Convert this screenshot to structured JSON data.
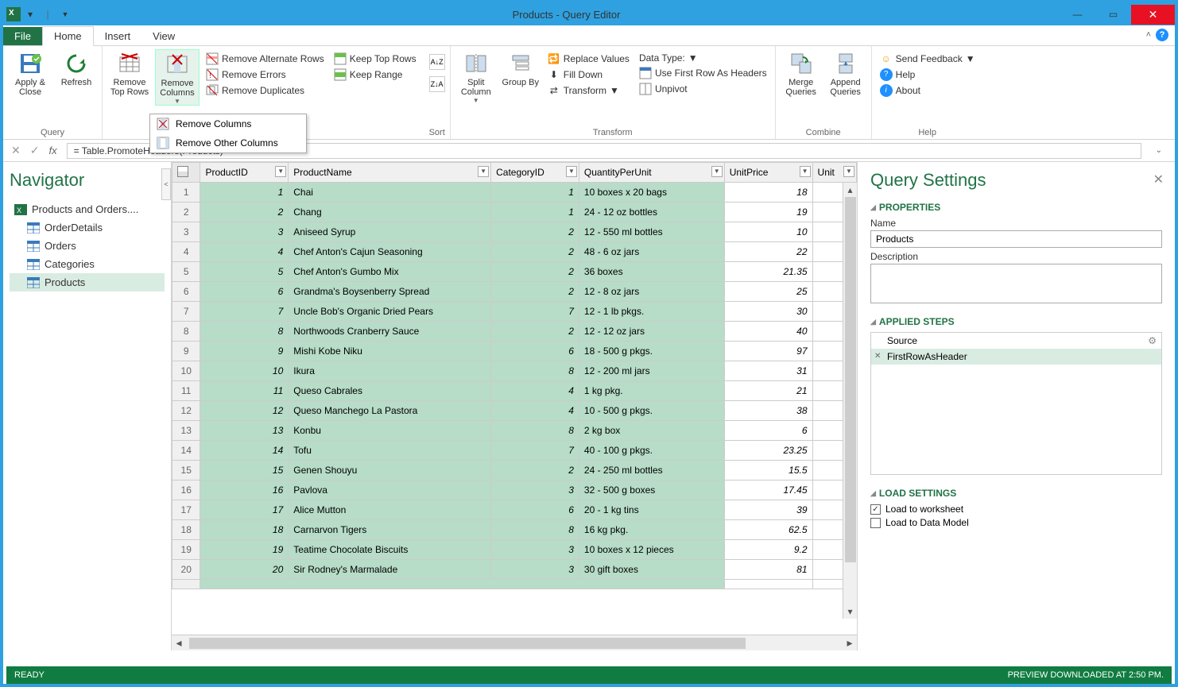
{
  "title": "Products - Query Editor",
  "tabs": {
    "file": "File",
    "home": "Home",
    "insert": "Insert",
    "view": "View"
  },
  "ribbon": {
    "query": {
      "apply_close": "Apply & Close",
      "refresh": "Refresh",
      "label": "Query"
    },
    "remove_top": "Remove Top Rows",
    "remove_cols": "Remove Columns",
    "remove_alt": "Remove Alternate Rows",
    "remove_errors": "Remove Errors",
    "remove_dup": "Remove Duplicates",
    "keep_top": "Keep Top Rows",
    "keep_range": "Keep Range",
    "sort_label": "Sort",
    "split_col": "Split Column",
    "group_by": "Group By",
    "replace": "Replace Values",
    "fill_down": "Fill Down",
    "transform": "Transform",
    "data_type": "Data Type:",
    "first_row": "Use First Row As Headers",
    "unpivot": "Unpivot",
    "transform_label": "Transform",
    "merge": "Merge Queries",
    "append": "Append Queries",
    "combine_label": "Combine",
    "feedback": "Send Feedback",
    "help": "Help",
    "about": "About",
    "help_label": "Help"
  },
  "dropdown": {
    "remove_cols": "Remove Columns",
    "remove_other": "Remove Other Columns"
  },
  "formula": "= Table.PromoteHeaders(Products)",
  "navigator": {
    "title": "Navigator",
    "root": "Products and Orders....",
    "items": [
      "OrderDetails",
      "Orders",
      "Categories",
      "Products"
    ],
    "selected": "Products"
  },
  "columns": [
    "ProductID",
    "ProductName",
    "CategoryID",
    "QuantityPerUnit",
    "UnitPrice",
    "Unit"
  ],
  "rows": [
    {
      "n": 1,
      "id": "1",
      "name": "Chai",
      "cat": "1",
      "qpu": "10 boxes x 20 bags",
      "price": "18"
    },
    {
      "n": 2,
      "id": "2",
      "name": "Chang",
      "cat": "1",
      "qpu": "24 - 12 oz bottles",
      "price": "19"
    },
    {
      "n": 3,
      "id": "3",
      "name": "Aniseed Syrup",
      "cat": "2",
      "qpu": "12 - 550 ml bottles",
      "price": "10"
    },
    {
      "n": 4,
      "id": "4",
      "name": "Chef Anton's Cajun Seasoning",
      "cat": "2",
      "qpu": "48 - 6 oz jars",
      "price": "22"
    },
    {
      "n": 5,
      "id": "5",
      "name": "Chef Anton's Gumbo Mix",
      "cat": "2",
      "qpu": "36 boxes",
      "price": "21.35"
    },
    {
      "n": 6,
      "id": "6",
      "name": "Grandma's Boysenberry Spread",
      "cat": "2",
      "qpu": "12 - 8 oz jars",
      "price": "25"
    },
    {
      "n": 7,
      "id": "7",
      "name": "Uncle Bob's Organic Dried Pears",
      "cat": "7",
      "qpu": "12 - 1 lb pkgs.",
      "price": "30"
    },
    {
      "n": 8,
      "id": "8",
      "name": "Northwoods Cranberry Sauce",
      "cat": "2",
      "qpu": "12 - 12 oz jars",
      "price": "40"
    },
    {
      "n": 9,
      "id": "9",
      "name": "Mishi Kobe Niku",
      "cat": "6",
      "qpu": "18 - 500 g pkgs.",
      "price": "97"
    },
    {
      "n": 10,
      "id": "10",
      "name": "Ikura",
      "cat": "8",
      "qpu": "12 - 200 ml jars",
      "price": "31"
    },
    {
      "n": 11,
      "id": "11",
      "name": "Queso Cabrales",
      "cat": "4",
      "qpu": "1 kg pkg.",
      "price": "21"
    },
    {
      "n": 12,
      "id": "12",
      "name": "Queso Manchego La Pastora",
      "cat": "4",
      "qpu": "10 - 500 g pkgs.",
      "price": "38"
    },
    {
      "n": 13,
      "id": "13",
      "name": "Konbu",
      "cat": "8",
      "qpu": "2 kg box",
      "price": "6"
    },
    {
      "n": 14,
      "id": "14",
      "name": "Tofu",
      "cat": "7",
      "qpu": "40 - 100 g pkgs.",
      "price": "23.25"
    },
    {
      "n": 15,
      "id": "15",
      "name": "Genen Shouyu",
      "cat": "2",
      "qpu": "24 - 250 ml bottles",
      "price": "15.5"
    },
    {
      "n": 16,
      "id": "16",
      "name": "Pavlova",
      "cat": "3",
      "qpu": "32 - 500 g boxes",
      "price": "17.45"
    },
    {
      "n": 17,
      "id": "17",
      "name": "Alice Mutton",
      "cat": "6",
      "qpu": "20 - 1 kg tins",
      "price": "39"
    },
    {
      "n": 18,
      "id": "18",
      "name": "Carnarvon Tigers",
      "cat": "8",
      "qpu": "16 kg pkg.",
      "price": "62.5"
    },
    {
      "n": 19,
      "id": "19",
      "name": "Teatime Chocolate Biscuits",
      "cat": "3",
      "qpu": "10 boxes x 12 pieces",
      "price": "9.2"
    },
    {
      "n": 20,
      "id": "20",
      "name": "Sir Rodney's Marmalade",
      "cat": "3",
      "qpu": "30 gift boxes",
      "price": "81"
    }
  ],
  "settings": {
    "title": "Query Settings",
    "properties": "PROPERTIES",
    "name_label": "Name",
    "name_value": "Products",
    "desc_label": "Description",
    "applied": "APPLIED STEPS",
    "steps": [
      "Source",
      "FirstRowAsHeader"
    ],
    "load": "LOAD SETTINGS",
    "load_ws": "Load to worksheet",
    "load_dm": "Load to Data Model"
  },
  "status": {
    "ready": "READY",
    "preview": "PREVIEW DOWNLOADED AT 2:50 PM."
  }
}
